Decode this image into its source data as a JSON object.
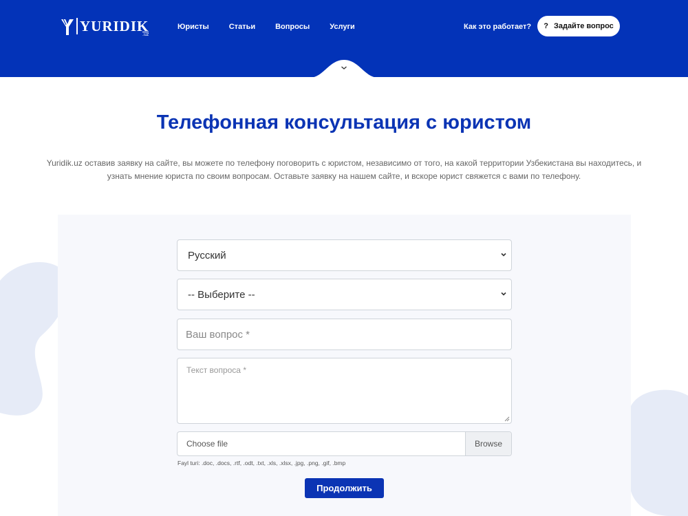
{
  "brand": {
    "logo_text": "YURIDIK",
    "logo_sub": ".uz",
    "primary_color": "#0333b8"
  },
  "nav": {
    "items": [
      "Юристы",
      "Статьи",
      "Вопросы",
      "Услуги"
    ],
    "how_it_works": "Как это работает?",
    "ask_button": "Задайте вопрос",
    "ask_icon": "?"
  },
  "main": {
    "title": "Телефонная консультация с юристом",
    "description": "Yuridik.uz оставив заявку на сайте, вы можете по телефону поговорить с юристом, независимо от того, на какой территории Узбекистана вы находитесь, и узнать мнение юриста по своим вопросам. Оставьте заявку на нашем сайте, и вскоре юрист свяжется с вами по телефону."
  },
  "form": {
    "language_select": "Русский",
    "category_select": "-- Выберите --",
    "question_placeholder": "Ваш вопрос *",
    "text_placeholder": "Текст вопроса *",
    "file_label": "Choose file",
    "browse_label": "Browse",
    "file_hint": "Fayl turi: .doc, .docs, .rtf, .odt, .txt, .xls, .xlsx, .jpg, .png, .gif, .bmp",
    "submit_label": "Продолжить"
  }
}
